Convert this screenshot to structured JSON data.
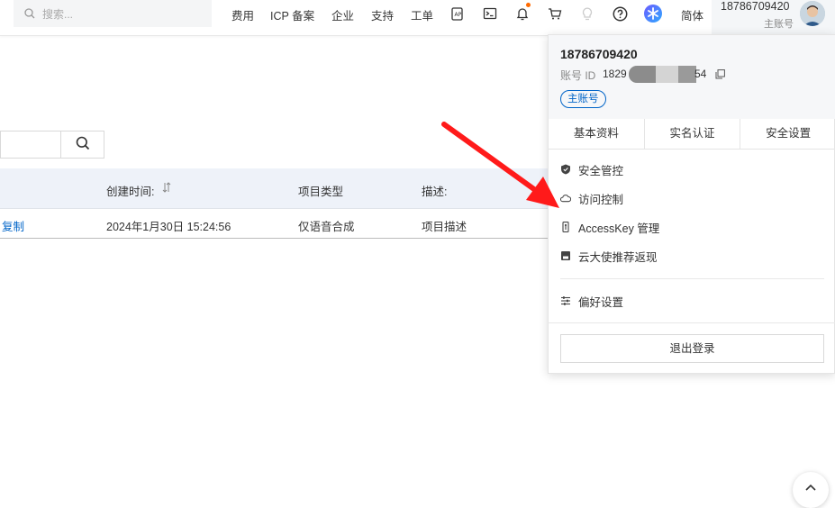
{
  "topbar": {
    "search_placeholder": "搜索...",
    "nav": [
      "费用",
      "ICP 备案",
      "企业",
      "支持",
      "工单"
    ],
    "lang": "简体",
    "user_name": "18786709420",
    "user_role": "主账号",
    "icons": [
      "api-icon",
      "terminal-icon",
      "bell-icon",
      "cart-icon",
      "lightbulb-icon",
      "help-icon",
      "ai-assistant-icon"
    ],
    "notification_color": "#ff6a00"
  },
  "table": {
    "columns": [
      "创建时间:",
      "项目类型",
      "描述:"
    ],
    "rows": [
      {
        "action": "复制",
        "created": "2024年1月30日 15:24:56",
        "type": "仅语音合成",
        "desc": "项目描述"
      }
    ]
  },
  "dropdown": {
    "user": "18786709420",
    "id_label": "账号 ID",
    "id_prefix": "1829",
    "id_suffix": "54",
    "badge": "主账号",
    "tabs": [
      "基本资料",
      "实名认证",
      "安全设置"
    ],
    "menu": [
      "安全管控",
      "访问控制",
      "AccessKey 管理",
      "云大使推荐返现"
    ],
    "preferences": "偏好设置",
    "logout": "退出登录"
  },
  "colors": {
    "link": "#0064c8",
    "arrow": "#ff1a1a"
  }
}
